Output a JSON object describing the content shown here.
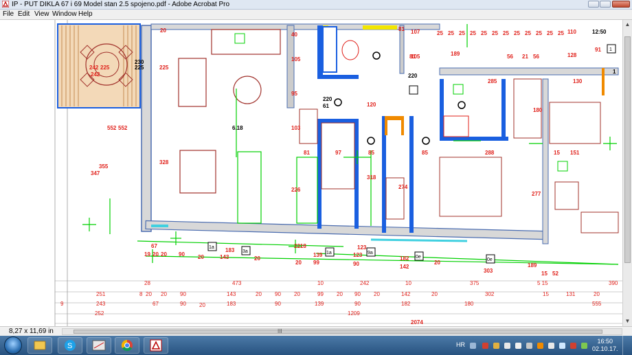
{
  "window": {
    "title": "IP - PUT DIKLA 67 i 69 Model stan 2.5 spojeno.pdf - Adobe Acrobat Pro"
  },
  "menu": {
    "items": [
      "File",
      "Edit",
      "View",
      "Window",
      "Help"
    ]
  },
  "statusbar": {
    "page_size": "8,27 x 11,69 in",
    "scroll_grip": "III"
  },
  "taskbar": {
    "language": "HR",
    "time": "16:50",
    "date": "02.10.17.",
    "apps": [
      "windows-explorer-icon",
      "skype-icon",
      "cad-app-icon",
      "chrome-icon",
      "acrobat-icon"
    ]
  },
  "plan": {
    "colors": {
      "wall": "#4a6cb0",
      "dim_red": "#e0201a",
      "green": "#00d000",
      "blue": "#1a5fe0",
      "brown": "#a0302a",
      "orange": "#f08a00",
      "cyan": "#40d0e0",
      "yellow": "#f2e600"
    },
    "labels_top": [
      "20",
      "40",
      "81",
      "107",
      "25",
      "25",
      "25",
      "25",
      "25",
      "25",
      "25",
      "25",
      "25",
      "25",
      "25",
      "25",
      "110",
      "12:50"
    ],
    "labels_mid": [
      "225",
      "225",
      "105",
      "95",
      "103",
      "6.18",
      "81",
      "105",
      "189",
      "56",
      "21",
      "56",
      "128",
      "91",
      "220",
      "61",
      "130",
      "285",
      "180",
      "151",
      "15",
      "328",
      "226",
      "318",
      "274",
      "277",
      "81",
      "97",
      "85",
      "85",
      "288",
      "123",
      "552",
      "552",
      "347",
      "355",
      "242",
      "242",
      "225",
      "230",
      "220",
      "120",
      "1"
    ],
    "labels_dims": [
      "67",
      "19",
      "20",
      "20",
      "90",
      "183",
      "143",
      "20",
      "20",
      "2218",
      "139",
      "20",
      "99",
      "123",
      "90",
      "182",
      "142",
      "20",
      "303",
      "189",
      "15",
      "52"
    ],
    "dim_row1": [
      "28",
      "473",
      "10",
      "242",
      "10",
      "375",
      "5 15",
      "390"
    ],
    "dim_row2": [
      "251",
      "8",
      "20",
      "20",
      "90",
      "143",
      "20",
      "90",
      "20",
      "99",
      "20",
      "90",
      "20",
      "142",
      "20",
      "302",
      "15",
      "131",
      "20"
    ],
    "dim_row3": [
      "9",
      "243",
      "67",
      "90",
      "20",
      "183",
      "90",
      "139",
      "90",
      "182",
      "180",
      "555"
    ],
    "dim_row4": [
      "252",
      "1209"
    ],
    "dim_total": "2074",
    "tags": [
      "1a",
      "3a",
      "1a",
      "9a",
      "0e",
      "0e",
      "1"
    ]
  }
}
